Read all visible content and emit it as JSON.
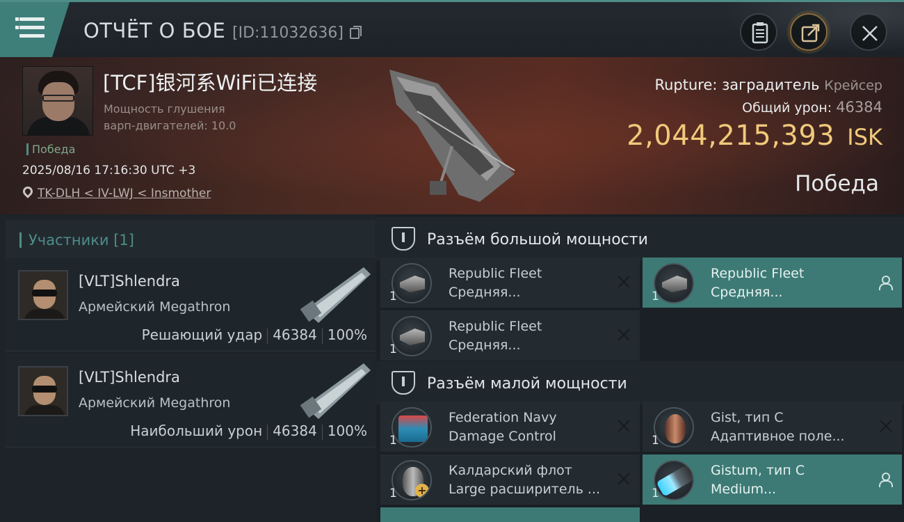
{
  "header": {
    "title": "ОТЧЁТ О БОЕ",
    "report_id": "[ID:11032636]",
    "icons": [
      "menu-icon",
      "copy-icon",
      "clipboard-icon",
      "share-icon",
      "close-icon"
    ]
  },
  "victim": {
    "pilot_name": "[TCF]银河系WiFi已连接",
    "sub_line1": "Мощность глушения",
    "sub_line2": "варп-двигателей: 10.0",
    "tag": "Победа",
    "datetime": "2025/08/16 17:16:30 UTC +3",
    "location": "TK-DLH < IV-LWJ < Insmother",
    "ship_name": "Rupture: заградитель",
    "ship_class": "Крейсер",
    "total_damage_label": "Общий урон:",
    "total_damage": "46384",
    "isk_value": "2,044,215,393",
    "isk_unit": "ISK",
    "result": "Победа"
  },
  "participants": {
    "header": "Участники [1]",
    "list": [
      {
        "name": "[VLT]Shlendra",
        "ship": "Армейский Megathron",
        "role": "Решающий удар",
        "damage": "46384",
        "percent": "100%"
      },
      {
        "name": "[VLT]Shlendra",
        "ship": "Армейский Megathron",
        "role": "Наибольший урон",
        "damage": "46384",
        "percent": "100%"
      }
    ]
  },
  "fittings": {
    "high_slots_label": "Разъём большой мощности",
    "low_slots_label": "Разъём малой мощности",
    "high": [
      {
        "line1": "Republic Fleet",
        "line2": "Средняя...",
        "qty": "1",
        "state": "destroyed"
      },
      {
        "line1": "Republic Fleet",
        "line2": "Средняя...",
        "qty": "1",
        "state": "dropped"
      },
      {
        "line1": "Republic Fleet",
        "line2": "Средняя...",
        "qty": "1",
        "state": "destroyed"
      }
    ],
    "low": [
      {
        "line1": "Federation Navy",
        "line2": "Damage Control",
        "qty": "1",
        "state": "destroyed"
      },
      {
        "line1": "Gist, тип C",
        "line2": "Адаптивное поле...",
        "qty": "1",
        "state": "destroyed"
      },
      {
        "line1": "Калдарский флот",
        "line2": "Large расширитель ...",
        "qty": "1",
        "state": "destroyed"
      },
      {
        "line1": "Gistum, тип C",
        "line2": "Medium...",
        "qty": "1",
        "state": "dropped"
      }
    ]
  },
  "colors": {
    "accent_teal": "#3d7a75",
    "isk_gold": "#f0c97a",
    "banner_red": "#5a2c22"
  }
}
